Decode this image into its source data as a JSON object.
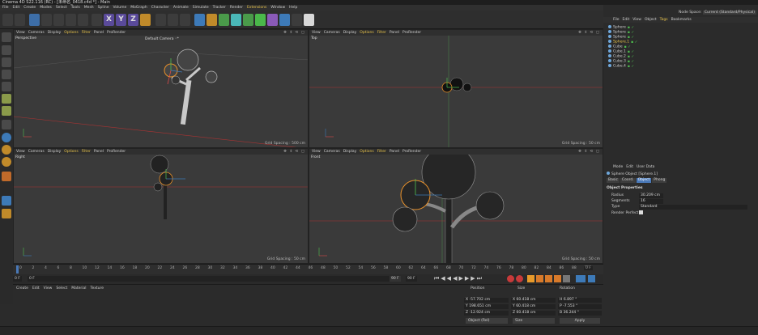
{
  "window": {
    "title": "Cinema 4D S22.116 (RC) - [未命名_0418.c4d *] - Main"
  },
  "menubar": [
    "File",
    "Edit",
    "Create",
    "Modes",
    "Select",
    "Tools",
    "Mesh",
    "Spline",
    "Volume",
    "MoGraph",
    "Character",
    "Animate",
    "Simulate",
    "Tracker",
    "Render",
    "Extensions",
    "Window",
    "Help"
  ],
  "viewport_menu": [
    "View",
    "Cameras",
    "Display",
    "Options",
    "Filter",
    "Panel",
    "ProRender"
  ],
  "viewports": {
    "perspective": {
      "name": "Perspective",
      "camera": "Default Camera ◦*",
      "grid": "Grid Spacing : 500 cm"
    },
    "top": {
      "name": "Top",
      "grid": "Grid Spacing : 50 cm"
    },
    "right": {
      "name": "Right",
      "grid": "Grid Spacing : 50 cm"
    },
    "front": {
      "name": "Front",
      "grid": "Grid Spacing : 50 cm"
    }
  },
  "object_manager": {
    "menu": [
      "File",
      "Edit",
      "View",
      "Object",
      "Tags",
      "Bookmarks"
    ],
    "node_space_label": "Node Space:",
    "node_space_value": "Current (Standard/Physical)",
    "objects": [
      "Sphere",
      "Sphere",
      "Sphere",
      "Sphere.1",
      "Cube",
      "Cube.1",
      "Cube.2",
      "Cube.3",
      "Cube.4"
    ]
  },
  "attribute_manager": {
    "menu": [
      "Mode",
      "Edit",
      "User Data"
    ],
    "title": "Sphere Object [Sphere.1]",
    "tabs": [
      "Basic",
      "Coord.",
      "Object",
      "Phong"
    ],
    "section": "Object Properties",
    "radius_label": "Radius",
    "radius_value": "30.209 cm",
    "segments_label": "Segments",
    "segments_value": "16",
    "type_label": "Type",
    "type_value": "Standard",
    "render_perfect_label": "Render Perfect"
  },
  "timeline": {
    "ticks": [
      "0",
      "2",
      "4",
      "6",
      "8",
      "10",
      "12",
      "14",
      "16",
      "18",
      "20",
      "22",
      "24",
      "26",
      "28",
      "30",
      "32",
      "34",
      "36",
      "38",
      "40",
      "42",
      "44",
      "46",
      "48",
      "50",
      "52",
      "54",
      "56",
      "58",
      "60",
      "62",
      "64",
      "66",
      "68",
      "70",
      "72",
      "74",
      "76",
      "78",
      "80",
      "82",
      "84",
      "86",
      "88",
      "90"
    ],
    "current": "0 F",
    "start": "0 F",
    "end_a": "90 F",
    "end_b": "90 F",
    "frame_box": "0 F"
  },
  "material_manager": {
    "menu": [
      "Create",
      "Edit",
      "View",
      "Select",
      "Material",
      "Texture"
    ]
  },
  "coordinates": {
    "headers": [
      "Position",
      "Size",
      "Rotation"
    ],
    "px": "-57.702 cm",
    "py": "198.651 cm",
    "pz": "-12.924 cm",
    "sx": "60.418 cm",
    "sy": "60.418 cm",
    "sz": "60.418 cm",
    "rh": "6.897 °",
    "rp": "-7.553 °",
    "rb": "36.244 °",
    "mode": "Object (Rel)",
    "size_mode": "Size",
    "apply": "Apply"
  }
}
